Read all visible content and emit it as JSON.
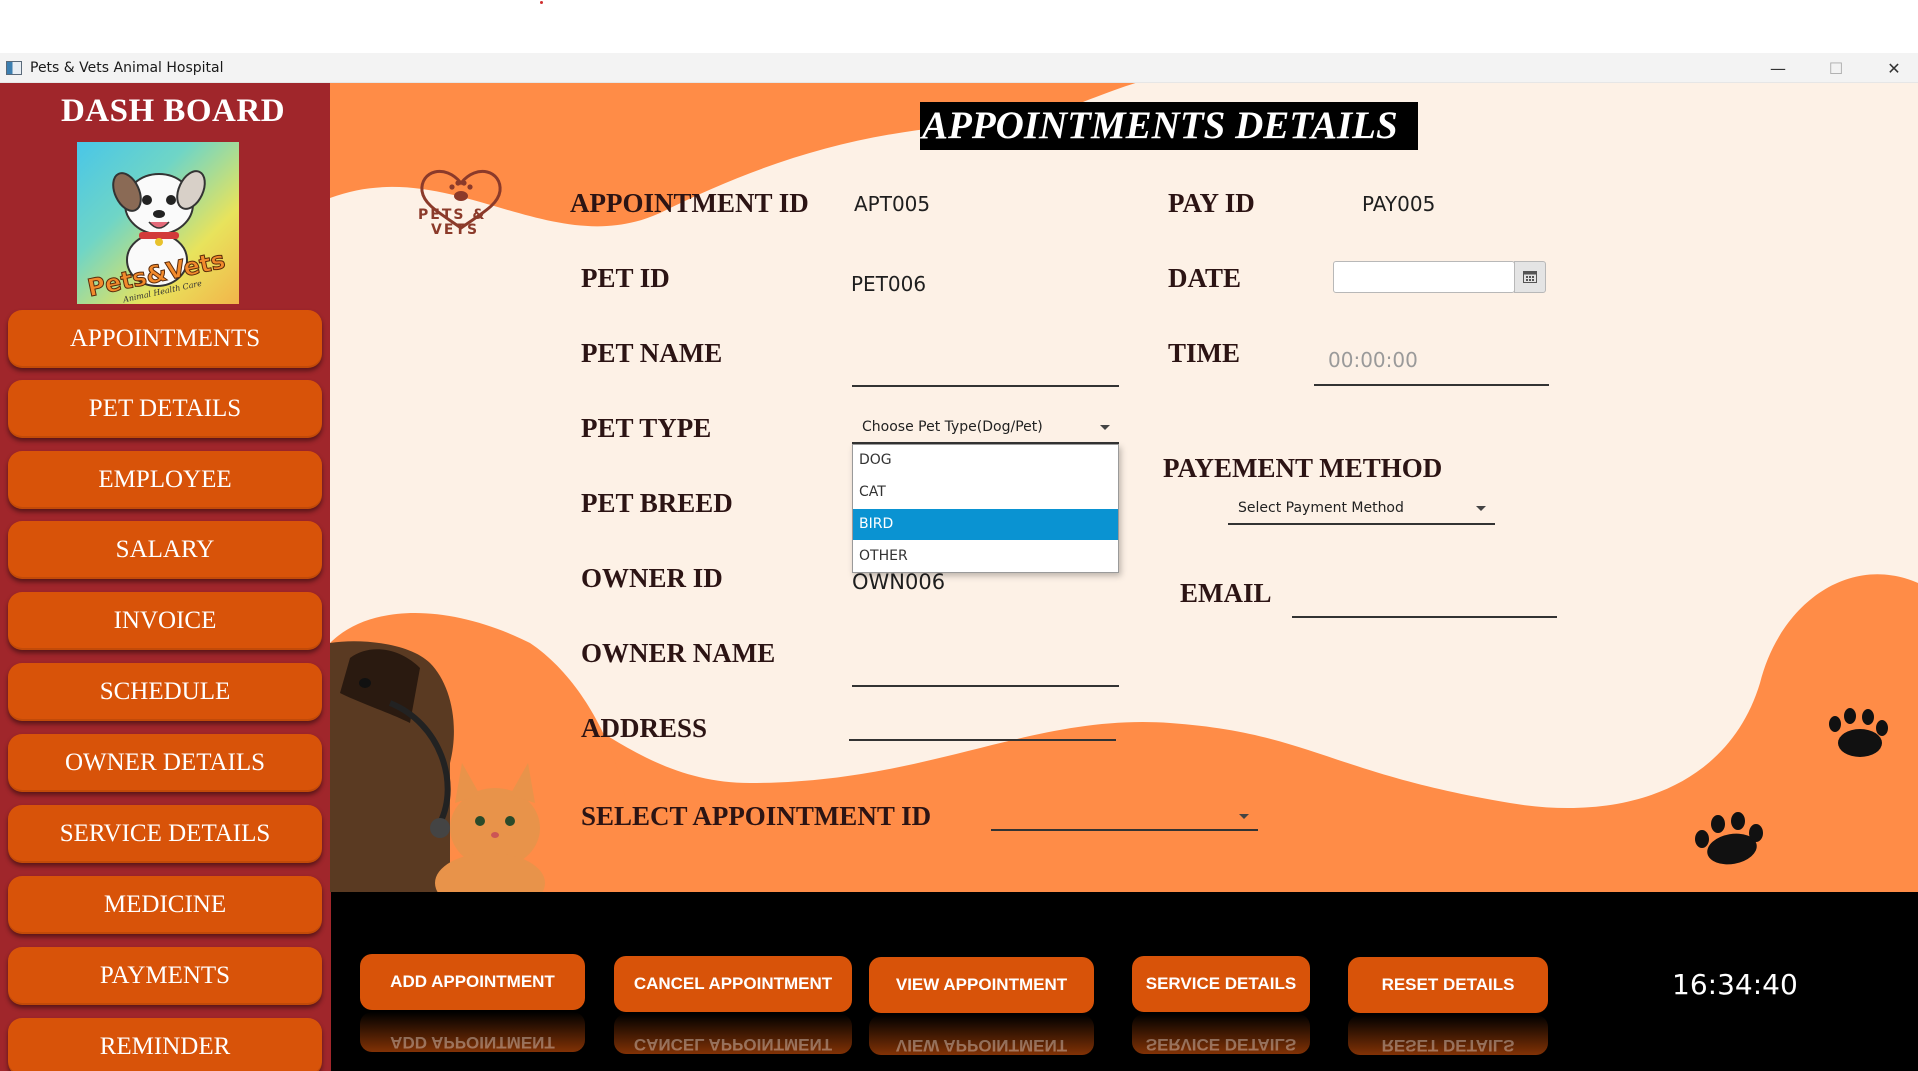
{
  "window": {
    "title": "Pets & Vets Animal Hospital",
    "minimize_glyph": "—",
    "maximize_glyph": "☐",
    "close_glyph": "✕"
  },
  "sidebar": {
    "title": "DASH BOARD",
    "logo_text": "Pets&Vets",
    "logo_subtext": "Animal Health Care",
    "items": [
      {
        "label": "APPOINTMENTS"
      },
      {
        "label": "PET DETAILS"
      },
      {
        "label": "EMPLOYEE"
      },
      {
        "label": "SALARY"
      },
      {
        "label": "INVOICE"
      },
      {
        "label": "SCHEDULE"
      },
      {
        "label": "OWNER DETAILS"
      },
      {
        "label": "SERVICE DETAILS"
      },
      {
        "label": "MEDICINE"
      },
      {
        "label": "PAYMENTS"
      },
      {
        "label": "REMINDER"
      }
    ]
  },
  "main": {
    "title": "APPOINTMENTS DETAILS",
    "brand_mark": {
      "line1": "PETS &",
      "line2": "VETS"
    },
    "fields": {
      "appointment_id": {
        "label": "APPOINTMENT ID",
        "value": "APT005"
      },
      "pay_id": {
        "label": "PAY ID",
        "value": "PAY005"
      },
      "pet_id": {
        "label": "PET ID",
        "value": "PET006"
      },
      "date": {
        "label": "DATE",
        "value": ""
      },
      "pet_name": {
        "label": "PET NAME",
        "value": ""
      },
      "time": {
        "label": "TIME",
        "placeholder": "00:00:00"
      },
      "pet_type": {
        "label": "PET TYPE",
        "placeholder": "Choose Pet Type(Dog/Pet)",
        "options": [
          "DOG",
          "CAT",
          "BIRD",
          "OTHER"
        ],
        "highlighted": "BIRD"
      },
      "payment_method": {
        "label": "PAYEMENT METHOD",
        "placeholder": "Select Payment Method"
      },
      "pet_breed": {
        "label": "PET BREED"
      },
      "owner_id": {
        "label": "OWNER ID",
        "value": "OWN006"
      },
      "email": {
        "label": "EMAIL",
        "value": ""
      },
      "owner_name": {
        "label": "OWNER NAME",
        "value": ""
      },
      "address": {
        "label": "ADDRESS",
        "value": ""
      },
      "select_appointment_id": {
        "label": "SELECT APPOINTMENT ID",
        "value": ""
      }
    }
  },
  "actions": {
    "add": "ADD APPOINTMENT",
    "cancel": "CANCEL APPOINTMENT",
    "view": "VIEW APPOINTMENT",
    "service": "SERVICE DETAILS",
    "reset": "RESET DETAILS"
  },
  "clock": "16:34:40",
  "colors": {
    "sidebar": "#a0262b",
    "button": "#d85309",
    "background_orange": "#ff8c47",
    "panel_cream": "#fdf1e6",
    "highlight": "#0a93d2"
  }
}
